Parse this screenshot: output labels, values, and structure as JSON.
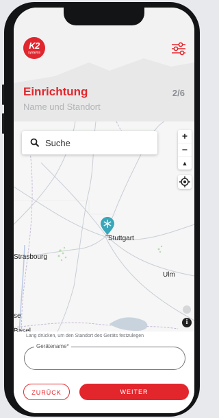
{
  "app": {
    "logo_text": "K2",
    "logo_subtext": "systems"
  },
  "header": {
    "title": "Einrichtung",
    "subtitle": "Name und Standort",
    "step": "2/6"
  },
  "search": {
    "placeholder": "Suche"
  },
  "map": {
    "zoom_in": "+",
    "zoom_out": "−",
    "north": "▲",
    "cities": [
      "Stuttgart",
      "Strasbourg",
      "Ulm",
      "Basel",
      "se"
    ],
    "info": "i"
  },
  "form": {
    "hint": "Lang drücken, um den Standort des Geräts festzulegen",
    "device_name_label": "Gerätename*",
    "device_name_value": ""
  },
  "buttons": {
    "back": "ZURÜCK",
    "next": "WEITER"
  },
  "colors": {
    "accent": "#e3262c",
    "marker": "#3aa6b9"
  }
}
